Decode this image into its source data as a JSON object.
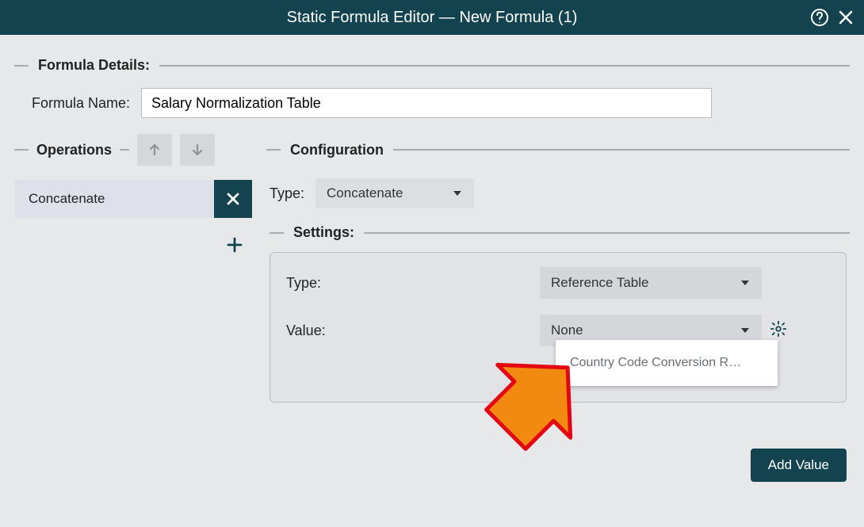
{
  "header": {
    "title": "Static Formula Editor — New Formula (1)"
  },
  "sections": {
    "formula_details": "Formula Details:",
    "operations": "Operations",
    "configuration": "Configuration",
    "settings": "Settings:"
  },
  "formula_name": {
    "label": "Formula Name:",
    "value": "Salary Normalization Table"
  },
  "operations": {
    "items": [
      {
        "label": "Concatenate"
      }
    ]
  },
  "config": {
    "type_label": "Type:",
    "type_value": "Concatenate",
    "settings": {
      "type_label": "Type:",
      "type_value": "Reference Table",
      "value_label": "Value:",
      "value_value": "None",
      "dropdown_option": "Country Code Conversion R…"
    },
    "add_value_label": "Add Value"
  }
}
